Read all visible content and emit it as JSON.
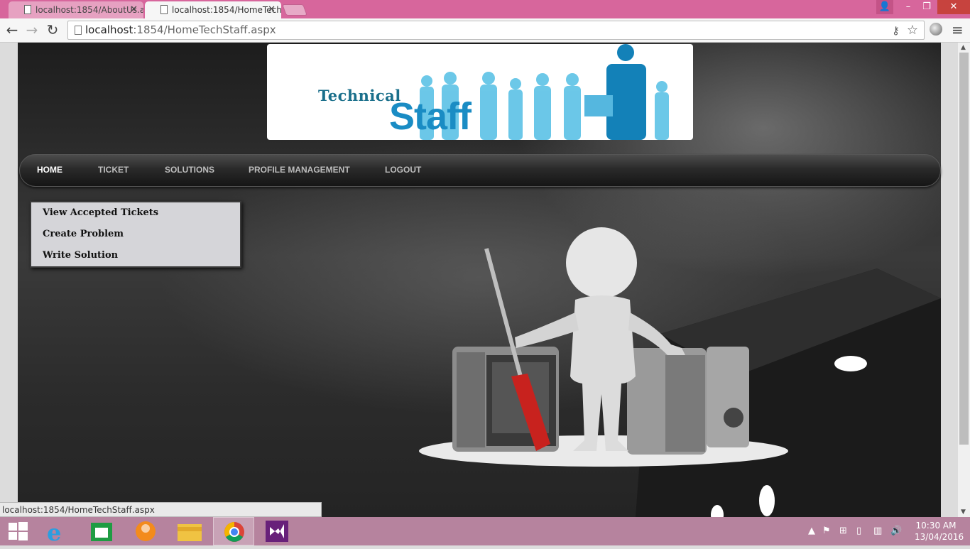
{
  "browser": {
    "tabs": [
      {
        "title": "localhost:1854/AboutUs.a",
        "active": false
      },
      {
        "title": "localhost:1854/HomeTech",
        "active": true
      }
    ],
    "url_host": "localhost",
    "url_rest": ":1854/HomeTechStaff.aspx",
    "status_url": "localhost:1854/HomeTechStaff.aspx"
  },
  "banner": {
    "line1": "Technical",
    "line2": "Staff"
  },
  "nav": {
    "items": [
      {
        "label": "HOME",
        "active": true
      },
      {
        "label": "TICKET",
        "active": false
      },
      {
        "label": "SOLUTIONS",
        "active": false
      },
      {
        "label": "PROFILE MANAGEMENT",
        "active": false
      },
      {
        "label": "LOGOUT",
        "active": false
      }
    ]
  },
  "dropdown": {
    "items": [
      "View Accepted Tickets",
      "Create Problem",
      "Write Solution"
    ]
  },
  "taskbar": {
    "apps": [
      "start-icon",
      "ie-icon",
      "store-icon",
      "media-player-icon",
      "file-explorer-icon",
      "chrome-icon",
      "visual-studio-icon"
    ],
    "time": "10:30 AM",
    "date": "13/04/2016"
  },
  "colors": {
    "titlebar": "#d7669c",
    "taskbar": "#b6839e",
    "nav_text": "#bdbdbd",
    "banner_blue": "#1a8cc4"
  }
}
